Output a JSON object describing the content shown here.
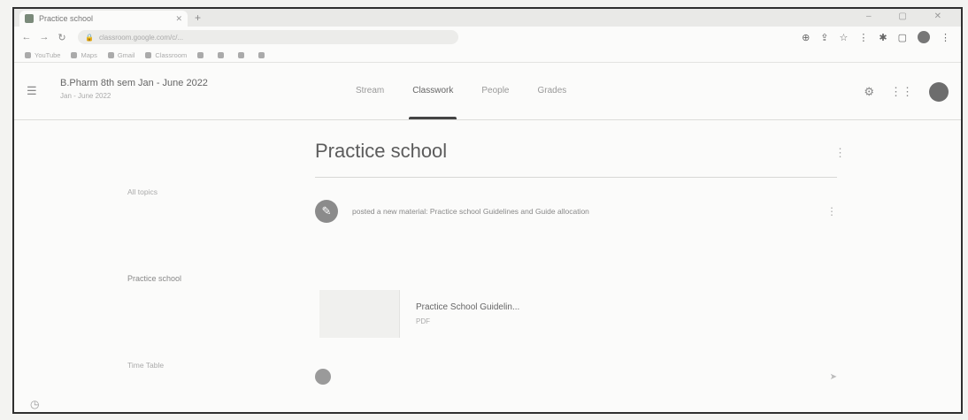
{
  "browser": {
    "tab_title": "Practice school",
    "url": "classroom.google.com/c/...",
    "bookmarks": [
      "YouTube",
      "Maps",
      "Gmail",
      "Classroom",
      "",
      "",
      "",
      "",
      "",
      ""
    ]
  },
  "classroom": {
    "class_name": "B.Pharm 8th sem Jan - June 2022",
    "class_subtitle": "Jan - June 2022",
    "tabs": [
      {
        "label": "Stream",
        "active": false
      },
      {
        "label": "Classwork",
        "active": true
      },
      {
        "label": "People",
        "active": false
      },
      {
        "label": "Grades",
        "active": false
      }
    ]
  },
  "sidebar": {
    "items": [
      {
        "label": "All topics",
        "current": false
      },
      {
        "label": "",
        "current": false
      },
      {
        "label": "",
        "current": false
      },
      {
        "label": "Practice school",
        "current": true
      },
      {
        "label": "",
        "current": false
      },
      {
        "label": "",
        "current": false
      },
      {
        "label": "Time Table",
        "current": false
      },
      {
        "label": "",
        "current": false
      }
    ]
  },
  "topic": {
    "title": "Practice school"
  },
  "post": {
    "text": "posted a new material: Practice school Guidelines and Guide allocation",
    "meta_date": "",
    "meta_label": "",
    "description": ""
  },
  "attachment": {
    "title": "Practice School Guidelin...",
    "type": "PDF"
  },
  "comment": {
    "placeholder": ""
  }
}
